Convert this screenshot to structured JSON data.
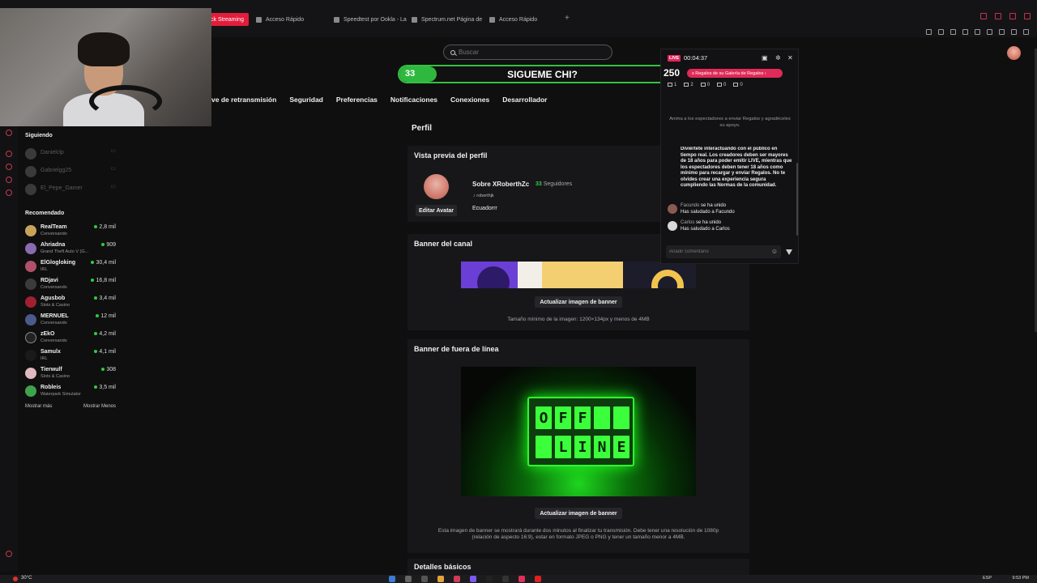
{
  "browser": {
    "tabs": [
      {
        "label": "ck Streaming",
        "active": true
      },
      {
        "label": "Acceso Rápido",
        "active": false
      },
      {
        "label": "Speedtest por Ookla - La",
        "active": false
      },
      {
        "label": "Spectrum.net Página de",
        "active": false
      },
      {
        "label": "Acceso Rápido",
        "active": false
      }
    ],
    "new_tab": "+"
  },
  "search": {
    "placeholder": "Buscar"
  },
  "goal": {
    "start": "33",
    "label": "SIGUEME CHI?",
    "end": "250",
    "progress_fraction": 0.13,
    "color": "#34c043"
  },
  "settings_nav": [
    "ve de retransmisión",
    "Seguridad",
    "Preferencias",
    "Notificaciones",
    "Conexiones",
    "Desarrollador"
  ],
  "sidebar": {
    "following_title": "Siguiendo",
    "following": [
      {
        "name": "Danielclp"
      },
      {
        "name": "Gabrielgg25"
      },
      {
        "name": "El_Pepe_Gamer"
      }
    ],
    "recommended_title": "Recomendado",
    "recommended": [
      {
        "name": "RealTeam",
        "category": "Conversando",
        "viewers": "2,8 mil"
      },
      {
        "name": "Ahriadna",
        "category": "Grand Theft Auto V (G...",
        "viewers": "909"
      },
      {
        "name": "ElGlogloking",
        "category": "IRL",
        "viewers": "30,4 mil"
      },
      {
        "name": "RDjavi",
        "category": "Conversando",
        "viewers": "16,8 mil"
      },
      {
        "name": "Agusbob",
        "category": "Slots & Casino",
        "viewers": "3,4 mil"
      },
      {
        "name": "MERNUEL",
        "category": "Conversando",
        "viewers": "12 mil"
      },
      {
        "name": "zEkO",
        "category": "Conversando",
        "viewers": "4,2 mil"
      },
      {
        "name": "Samulx",
        "category": "IRL",
        "viewers": "4,1 mil"
      },
      {
        "name": "Tierwulf",
        "category": "Slots & Casino",
        "viewers": "308"
      },
      {
        "name": "Robleis",
        "category": "Waterpark Simulator",
        "viewers": "3,5 mil"
      }
    ],
    "show_more": "Mostrar más",
    "show_less": "Mostrar Menos"
  },
  "main": {
    "profile_title": "Perfil",
    "preview_title": "Vista previa del perfil",
    "profile_name": "Sobre XRoberthZc",
    "followers_count": "33",
    "followers_label": "Seguidores",
    "tiktok_handle": "roberthjk",
    "country": "Ecuadorrr",
    "edit_avatar": "Editar Avatar",
    "banner_title": "Banner del canal",
    "update_banner": "Actualizar imagen de banner",
    "banner_hint": "Tamaño mínimo de la imagen: 1200×134px y menos de 4MB",
    "offline_title": "Banner de fuera de línea",
    "offline_row1": [
      "O",
      "F",
      "F",
      "",
      ""
    ],
    "offline_row2": [
      "",
      "L",
      "I",
      "N",
      "E"
    ],
    "update_offline": "Actualizar imagen de banner",
    "offline_hint_1": "Esta imagen de banner se mostrará durante dos minutos al finalizar tu transmisión. Debe tener una resolución de 1080p",
    "offline_hint_2": "(relación de aspecto 16:9), estar en formato JPEG o PNG y tener un tamaño menor a 4MB.",
    "details_title": "Detalles básicos"
  },
  "live_panel": {
    "badge": "LIVE",
    "timer": "00:04:37",
    "gift_banner": "s Regalos de su Galería de Regalos  ›",
    "stats": [
      "1",
      "2",
      "0",
      "0",
      "0"
    ],
    "encourage": "Anima a los espectadores a enviar Regalos y agradéceles su apoyo.",
    "rules": "Diviértete interactuando con el público en tiempo real. Los creadores deben ser mayores de 18 años para poder emitir LIVE, mientras que los espectadores deben tener 18 años como mínimo para recargar y enviar Regalos. No te olvides crear una experiencia segura cumpliendo las Normas de la comunidad.",
    "chat": [
      {
        "user": "Facundo",
        "action": "se ha unido",
        "reply": "Has saludado a Facundo"
      },
      {
        "user": "Carlos",
        "action": "se ha unido",
        "reply": "Has saludado a Carlos"
      }
    ],
    "comment_placeholder": "Añadir comentario"
  },
  "taskbar": {
    "temp": "30°C",
    "lang": "ESP",
    "clock": "9:53 PM"
  },
  "colors": {
    "accent": "#e21d3c",
    "live_green": "#2fb83e",
    "offline_green": "#3cff3c"
  }
}
